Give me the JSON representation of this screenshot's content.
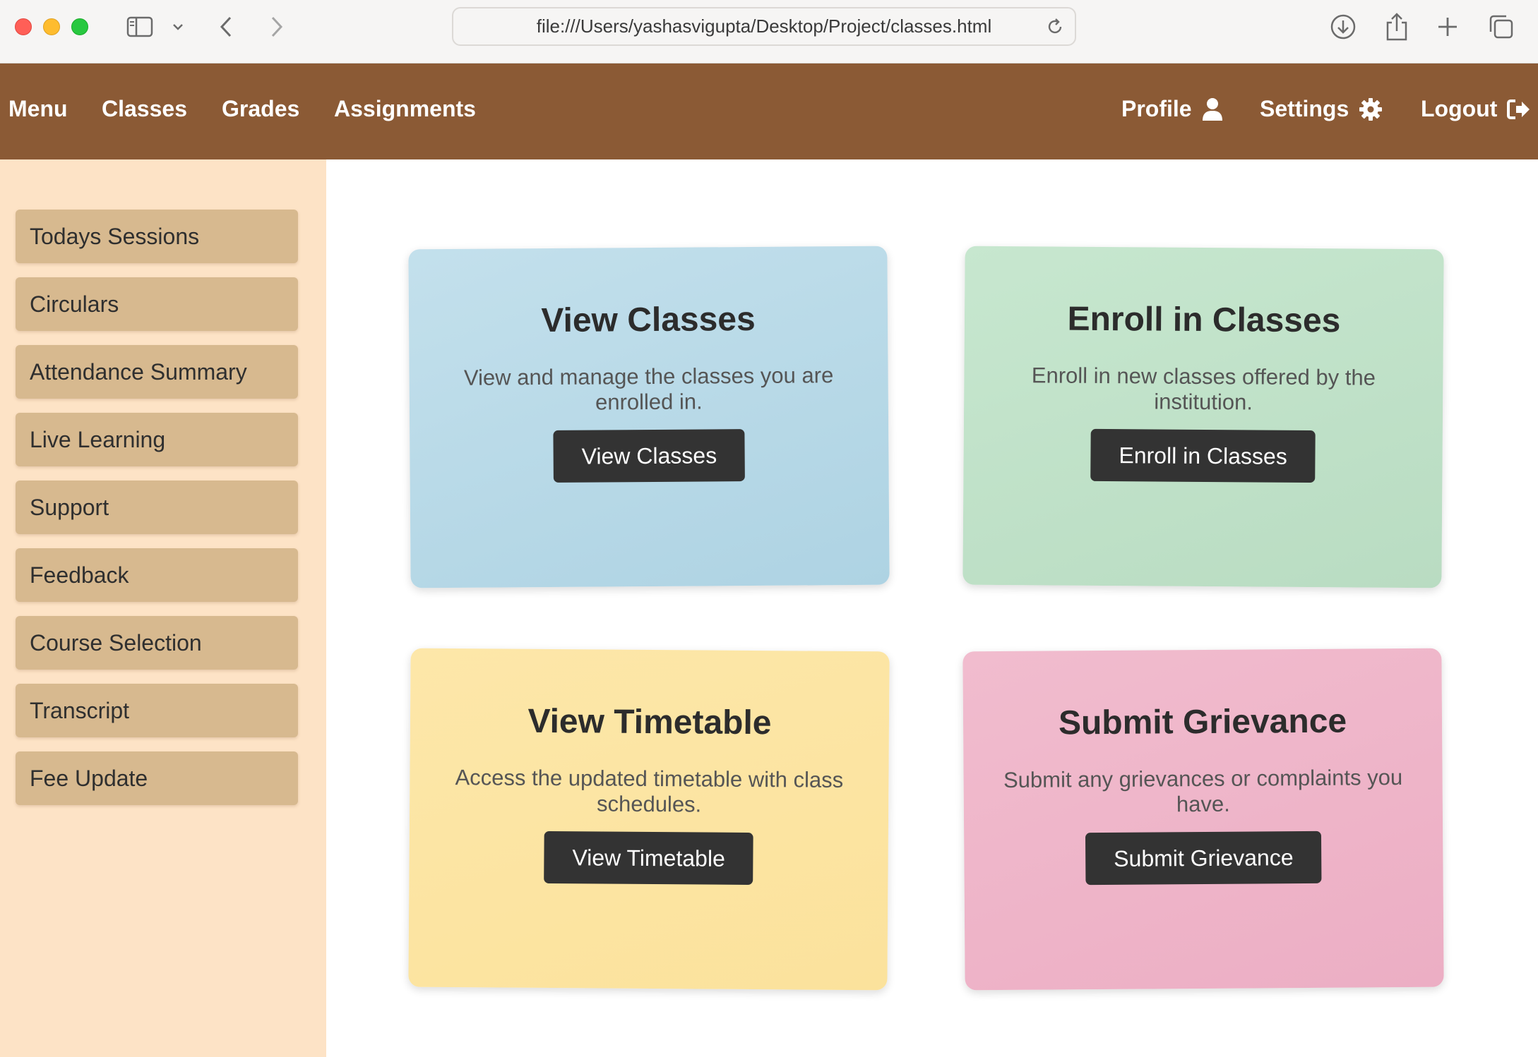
{
  "browser": {
    "url": "file:///Users/yashasvigupta/Desktop/Project/classes.html"
  },
  "navbar": {
    "left": [
      "Menu",
      "Classes",
      "Grades",
      "Assignments"
    ],
    "profile": "Profile",
    "settings": "Settings",
    "logout": "Logout"
  },
  "sidebar": {
    "items": [
      "Todays Sessions",
      "Circulars",
      "Attendance Summary",
      "Live Learning",
      "Support",
      "Feedback",
      "Course Selection",
      "Transcript",
      "Fee Update"
    ]
  },
  "cards": [
    {
      "title": "View Classes",
      "description": "View and manage the classes you are enrolled in.",
      "button": "View Classes"
    },
    {
      "title": "Enroll in Classes",
      "description": "Enroll in new classes offered by the institution.",
      "button": "Enroll in Classes"
    },
    {
      "title": "View Timetable",
      "description": "Access the updated timetable with class schedules.",
      "button": "View Timetable"
    },
    {
      "title": "Submit Grievance",
      "description": "Submit any grievances or complaints you have.",
      "button": "Submit Grievance"
    }
  ],
  "colors": {
    "navbar": "#8b5a35",
    "sidebar": "#fde3c6",
    "sidebar_item": "#d7b98f",
    "card_blue": "#b9dae8",
    "card_green": "#c0e1c8",
    "card_yellow": "#fce5a3",
    "card_pink": "#efb5ca",
    "button": "#333333"
  },
  "icons": {
    "profile": "user-icon",
    "settings": "gear-icon",
    "logout": "logout-icon"
  }
}
